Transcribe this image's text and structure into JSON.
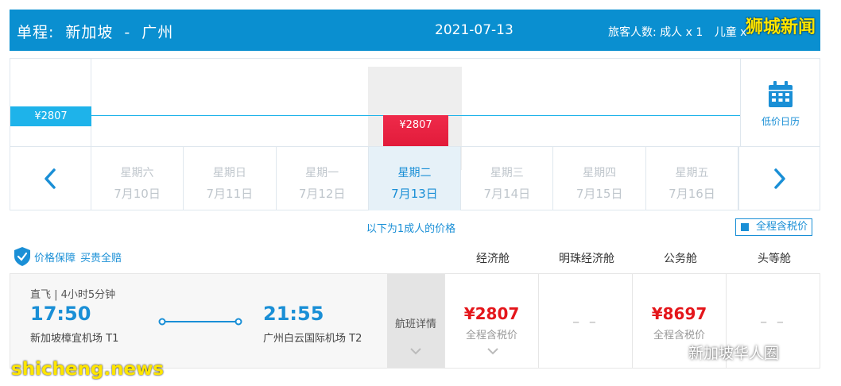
{
  "header": {
    "trip_type": "单程:",
    "origin": "新加坡",
    "dash": "-",
    "destination": "广州",
    "date": "2021-07-13",
    "pax_label": "旅客人数:",
    "adults": "成人 x 1",
    "children": "儿童 x"
  },
  "watermarks": {
    "top": "狮城新闻",
    "bottom": "shicheng.news",
    "bottom_right": "新加坡华人圈"
  },
  "trend": {
    "base_price": "¥2807",
    "selected_price": "¥2807",
    "calendar_label": "低价日历",
    "days": [
      {
        "weekday": "星期六",
        "date": "7月10日",
        "selected": false
      },
      {
        "weekday": "星期日",
        "date": "7月11日",
        "selected": false
      },
      {
        "weekday": "星期一",
        "date": "7月12日",
        "selected": false
      },
      {
        "weekday": "星期二",
        "date": "7月13日",
        "selected": true
      },
      {
        "weekday": "星期三",
        "date": "7月14日",
        "selected": false
      },
      {
        "weekday": "星期四",
        "date": "7月15日",
        "selected": false
      },
      {
        "weekday": "星期五",
        "date": "7月16日",
        "selected": false
      }
    ]
  },
  "note": "以下为1成人的价格",
  "tax_toggle": "全程含税价",
  "guarantee": {
    "label1": "价格保障",
    "label2": "买贵全赔"
  },
  "cabins": [
    "经济舱",
    "明珠经济舱",
    "公务舱",
    "头等舱"
  ],
  "flight": {
    "type": "直飞 | 4小时5分钟",
    "dep_time": "17:50",
    "dep_airport": "新加坡樟宜机场 T1",
    "arr_time": "21:55",
    "arr_airport": "广州白云国际机场 T2",
    "detail_label": "航班详情",
    "fares": [
      {
        "price": "¥2807",
        "sub": "全程含税价"
      },
      {
        "price": "",
        "sub": "",
        "empty": "– –"
      },
      {
        "price": "¥8697",
        "sub": "全程含税价"
      },
      {
        "price": "",
        "sub": "",
        "empty": "– –"
      }
    ]
  },
  "colors": {
    "header_bg": "#0a8fd0",
    "accent": "#1a8fd6",
    "price_red": "#e4161b",
    "flag_red": "#e8213f"
  }
}
